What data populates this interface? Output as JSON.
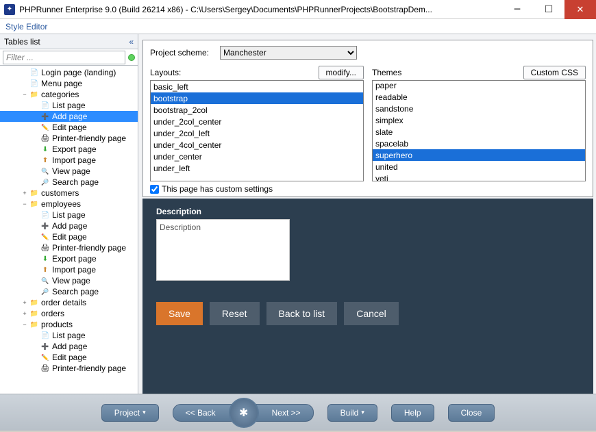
{
  "window": {
    "title": "PHPRunner Enterprise 9.0 (Build 26214 x86) - C:\\Users\\Sergey\\Documents\\PHPRunnerProjects\\BootstrapDem..."
  },
  "menubar": {
    "style_editor": "Style Editor"
  },
  "sidebar": {
    "header": "Tables list",
    "collapse_glyph": "«",
    "filter_placeholder": "Filter ...",
    "tree": [
      {
        "label": "Login page (landing)",
        "depth": 2,
        "exp": "",
        "icon": "page"
      },
      {
        "label": "Menu page",
        "depth": 2,
        "exp": "",
        "icon": "page"
      },
      {
        "label": "categories",
        "depth": 2,
        "exp": "−",
        "icon": "folder",
        "children": [
          {
            "label": "List page",
            "icon": "page"
          },
          {
            "label": "Add page",
            "icon": "add",
            "selected": true
          },
          {
            "label": "Edit page",
            "icon": "edit"
          },
          {
            "label": "Printer-friendly page",
            "icon": "print"
          },
          {
            "label": "Export page",
            "icon": "export"
          },
          {
            "label": "Import page",
            "icon": "import"
          },
          {
            "label": "View page",
            "icon": "view"
          },
          {
            "label": "Search page",
            "icon": "search"
          }
        ]
      },
      {
        "label": "customers",
        "depth": 2,
        "exp": "+",
        "icon": "folder"
      },
      {
        "label": "employees",
        "depth": 2,
        "exp": "−",
        "icon": "folder",
        "children": [
          {
            "label": "List page",
            "icon": "page"
          },
          {
            "label": "Add page",
            "icon": "add"
          },
          {
            "label": "Edit page",
            "icon": "edit"
          },
          {
            "label": "Printer-friendly page",
            "icon": "print"
          },
          {
            "label": "Export page",
            "icon": "export"
          },
          {
            "label": "Import page",
            "icon": "import"
          },
          {
            "label": "View page",
            "icon": "view"
          },
          {
            "label": "Search page",
            "icon": "search"
          }
        ]
      },
      {
        "label": "order details",
        "depth": 2,
        "exp": "+",
        "icon": "folder"
      },
      {
        "label": "orders",
        "depth": 2,
        "exp": "+",
        "icon": "folder"
      },
      {
        "label": "products",
        "depth": 2,
        "exp": "−",
        "icon": "folder",
        "children": [
          {
            "label": "List page",
            "icon": "page"
          },
          {
            "label": "Add page",
            "icon": "add"
          },
          {
            "label": "Edit page",
            "icon": "edit"
          },
          {
            "label": "Printer-friendly page",
            "icon": "print"
          }
        ]
      }
    ]
  },
  "settings": {
    "scheme_label": "Project scheme:",
    "scheme_value": "Manchester",
    "layouts_label": "Layouts:",
    "modify_button": "modify...",
    "layouts": [
      "basic_left",
      "bootstrap",
      "bootstrap_2col",
      "under_2col_center",
      "under_2col_left",
      "under_4col_center",
      "under_center",
      "under_left"
    ],
    "layouts_selected": "bootstrap",
    "themes_label": "Themes",
    "custom_css_button": "Custom CSS",
    "themes": [
      "paper",
      "readable",
      "sandstone",
      "simplex",
      "slate",
      "spacelab",
      "superhero",
      "united",
      "yeti"
    ],
    "themes_selected": "superhero",
    "custom_settings_label": "This page has custom settings",
    "custom_settings_checked": true
  },
  "preview": {
    "field_label": "Description",
    "textarea_value": "Description",
    "buttons": {
      "save": "Save",
      "reset": "Reset",
      "back": "Back to list",
      "cancel": "Cancel"
    },
    "colors": {
      "background": "#2b3e50",
      "primary_button": "#d9752b",
      "secondary_button": "#4e5d6c"
    }
  },
  "footer": {
    "project": "Project",
    "back": "<<  Back",
    "next": "Next  >>",
    "build": "Build",
    "help": "Help",
    "close": "Close"
  }
}
